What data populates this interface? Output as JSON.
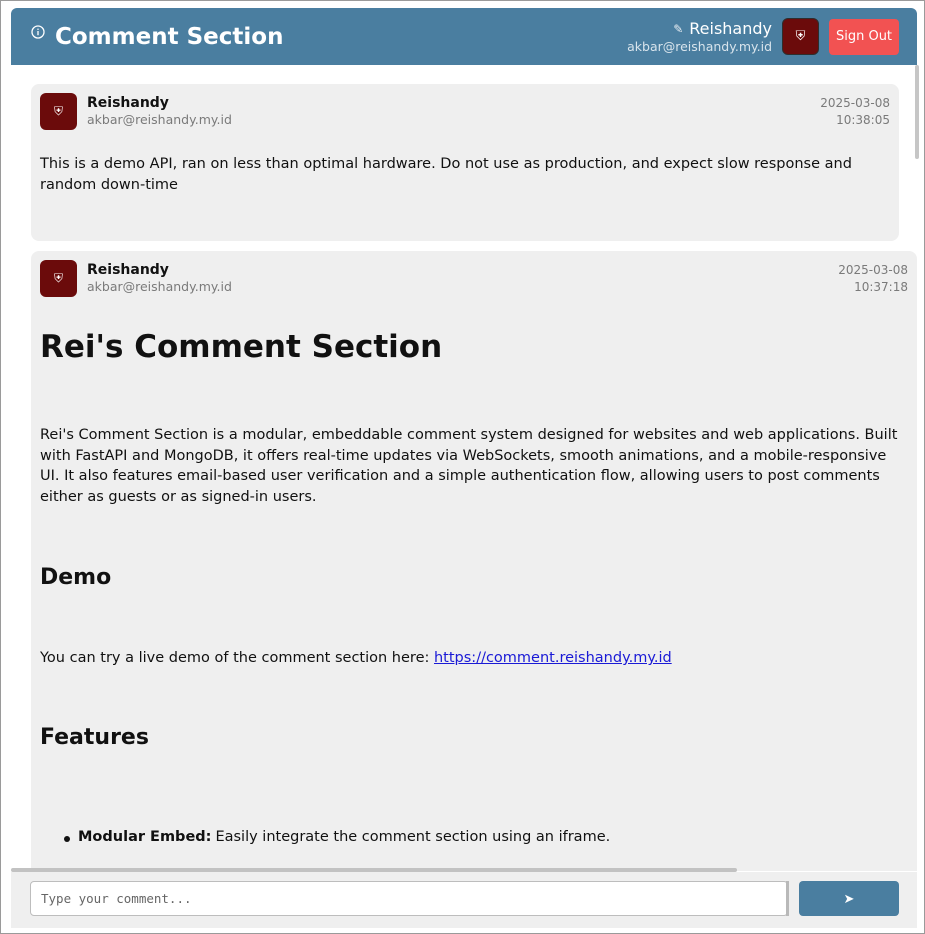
{
  "header": {
    "title": "Comment Section",
    "user_name": "Reishandy",
    "user_email": "akbar@reishandy.my.id",
    "sign_out_label": "Sign Out",
    "pen_icon": "✎",
    "avatar_icon": "⛨"
  },
  "comments": [
    {
      "name": "Reishandy",
      "email": "akbar@reishandy.my.id",
      "date": "2025-03-08",
      "time": "10:38:05",
      "text": "This is a demo API, ran on less than optimal hardware. Do not use as production, and expect slow response and random down-time"
    },
    {
      "name": "Reishandy",
      "email": "akbar@reishandy.my.id",
      "date": "2025-03-08",
      "time": "10:37:18",
      "heading": "Rei's Comment Section",
      "intro": "Rei's Comment Section is a modular, embeddable comment system designed for websites and web applications. Built with FastAPI and MongoDB, it offers real-time updates via WebSockets, smooth animations, and a mobile-responsive UI. It also features email-based user verification and a simple authentication flow, allowing users to post comments either as guests or as signed-in users.",
      "demo_heading": "Demo",
      "demo_text": "You can try a live demo of the comment section here:",
      "demo_link": "https://comment.reishandy.my.id",
      "features_heading": "Features",
      "feature_1_title": "Modular Embed:",
      "feature_1_text": "Easily integrate the comment section using an iframe."
    }
  ],
  "composer": {
    "placeholder": "Type your comment...",
    "send_label": "➤"
  },
  "colors": {
    "header": "#4a7ea0",
    "avatar": "#6b0b0b",
    "sign_out": "#f25252",
    "card": "#efefef"
  }
}
